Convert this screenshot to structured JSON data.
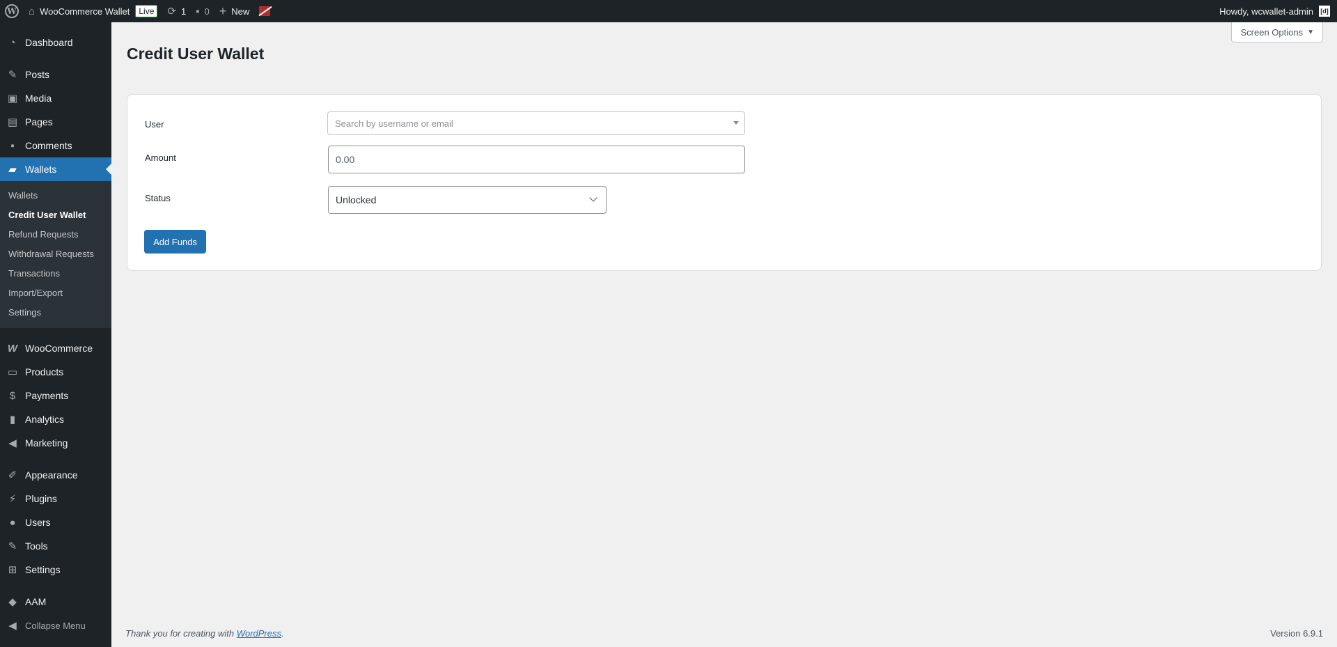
{
  "adminbar": {
    "site_name": "WooCommerce Wallet",
    "live_badge": "Live",
    "updates_count": "1",
    "comments_count": "0",
    "new_label": "New",
    "howdy": "Howdy, wcwallet-admin",
    "avatar_text": "[d]"
  },
  "screen_options": {
    "label": "Screen Options"
  },
  "sidebar": {
    "top_items": [
      {
        "label": "Dashboard",
        "icon": "dashboard-icon"
      },
      {
        "label": "Posts",
        "icon": "pin-icon"
      },
      {
        "label": "Media",
        "icon": "media-icon"
      },
      {
        "label": "Pages",
        "icon": "pages-icon"
      },
      {
        "label": "Comments",
        "icon": "comments-icon"
      },
      {
        "label": "Wallets",
        "icon": "wallet-icon"
      }
    ],
    "wallet_submenu": [
      {
        "label": "Wallets"
      },
      {
        "label": "Credit User Wallet"
      },
      {
        "label": "Refund Requests"
      },
      {
        "label": "Withdrawal Requests"
      },
      {
        "label": "Transactions"
      },
      {
        "label": "Import/Export"
      },
      {
        "label": "Settings"
      }
    ],
    "commerce_items": [
      {
        "label": "WooCommerce",
        "icon": "woocommerce-icon"
      },
      {
        "label": "Products",
        "icon": "archive-icon"
      },
      {
        "label": "Payments",
        "icon": "dollar-icon"
      },
      {
        "label": "Analytics",
        "icon": "chart-icon"
      },
      {
        "label": "Marketing",
        "icon": "megaphone-icon"
      }
    ],
    "admin_items": [
      {
        "label": "Appearance",
        "icon": "brush-icon"
      },
      {
        "label": "Plugins",
        "icon": "plugin-icon"
      },
      {
        "label": "Users",
        "icon": "user-icon"
      },
      {
        "label": "Tools",
        "icon": "wrench-icon"
      },
      {
        "label": "Settings",
        "icon": "sliders-icon"
      }
    ],
    "aam_label": "AAM",
    "collapse_label": "Collapse Menu"
  },
  "main": {
    "title": "Credit User Wallet",
    "form": {
      "user_label": "User",
      "user_placeholder": "Search by username or email",
      "amount_label": "Amount",
      "amount_value": "0.00",
      "status_label": "Status",
      "status_value": "Unlocked",
      "submit_label": "Add Funds"
    }
  },
  "footer": {
    "thanks_prefix": "Thank you for creating with ",
    "thanks_link": "WordPress",
    "thanks_suffix": ".",
    "version": "Version 6.9.1"
  },
  "colors": {
    "accent": "#2271b1",
    "admin_bg": "#1d2327",
    "page_bg": "#f0f0f1"
  }
}
